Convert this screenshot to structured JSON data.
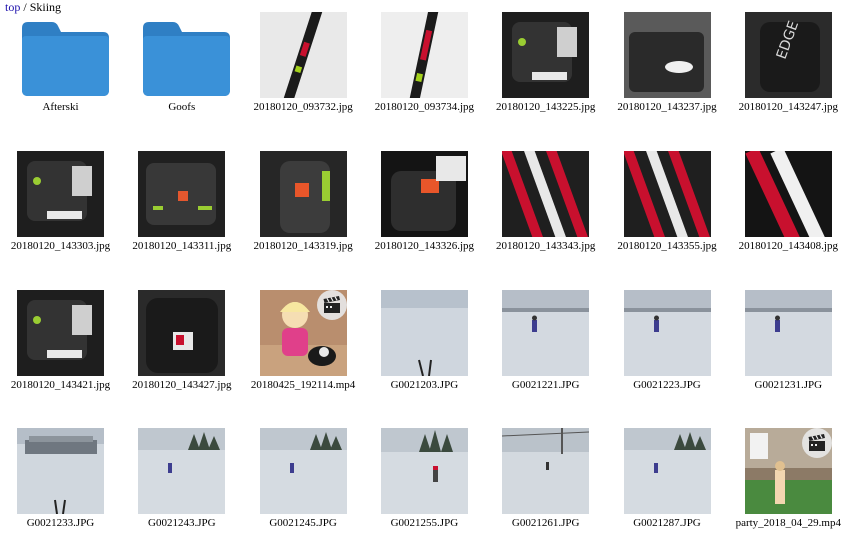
{
  "breadcrumb": {
    "root": "top",
    "separator": " / ",
    "current": "Skiing"
  },
  "items": [
    {
      "name": "Afterski",
      "kind": "folder"
    },
    {
      "name": "Goofs",
      "kind": "folder"
    },
    {
      "name": "20180120_093732.jpg",
      "kind": "image",
      "scene": "ski-snow"
    },
    {
      "name": "20180120_093734.jpg",
      "kind": "image",
      "scene": "ski-snow-red"
    },
    {
      "name": "20180120_143225.jpg",
      "kind": "image",
      "scene": "boot-dark"
    },
    {
      "name": "20180120_143237.jpg",
      "kind": "image",
      "scene": "boot-gray"
    },
    {
      "name": "20180120_143247.jpg",
      "kind": "image",
      "scene": "boot-edge"
    },
    {
      "name": "20180120_143303.jpg",
      "kind": "image",
      "scene": "boot-dark"
    },
    {
      "name": "20180120_143311.jpg",
      "kind": "image",
      "scene": "boot-green"
    },
    {
      "name": "20180120_143319.jpg",
      "kind": "image",
      "scene": "boot-orange"
    },
    {
      "name": "20180120_143326.jpg",
      "kind": "image",
      "scene": "boot-orange-bag"
    },
    {
      "name": "20180120_143343.jpg",
      "kind": "image",
      "scene": "skis-red"
    },
    {
      "name": "20180120_143355.jpg",
      "kind": "image",
      "scene": "skis-red"
    },
    {
      "name": "20180120_143408.jpg",
      "kind": "image",
      "scene": "skis-red-2"
    },
    {
      "name": "20180120_143421.jpg",
      "kind": "image",
      "scene": "boot-dark"
    },
    {
      "name": "20180120_143427.jpg",
      "kind": "image",
      "scene": "boot-black"
    },
    {
      "name": "20180425_192114.mp4",
      "kind": "video",
      "scene": "indoor-girl"
    },
    {
      "name": "G0021203.JPG",
      "kind": "image",
      "scene": "slope"
    },
    {
      "name": "G0021221.JPG",
      "kind": "image",
      "scene": "slope-skier"
    },
    {
      "name": "G0021223.JPG",
      "kind": "image",
      "scene": "slope-skier"
    },
    {
      "name": "G0021231.JPG",
      "kind": "image",
      "scene": "slope-skier"
    },
    {
      "name": "G0021233.JPG",
      "kind": "image",
      "scene": "slope-building"
    },
    {
      "name": "G0021243.JPG",
      "kind": "image",
      "scene": "slope-trees"
    },
    {
      "name": "G0021245.JPG",
      "kind": "image",
      "scene": "slope-trees"
    },
    {
      "name": "G0021255.JPG",
      "kind": "image",
      "scene": "slope-trees-skier"
    },
    {
      "name": "G0021261.JPG",
      "kind": "image",
      "scene": "slope-lift"
    },
    {
      "name": "G0021287.JPG",
      "kind": "image",
      "scene": "slope-trees"
    },
    {
      "name": "party_2018_04_29.mp4",
      "kind": "video",
      "scene": "indoor-party"
    }
  ],
  "colors": {
    "folder_body": "#3a91d8",
    "folder_tab": "#2f7fc4",
    "link": "#1a0dab"
  },
  "icons": {
    "folder": "folder-icon",
    "video": "video-clapper-icon"
  }
}
